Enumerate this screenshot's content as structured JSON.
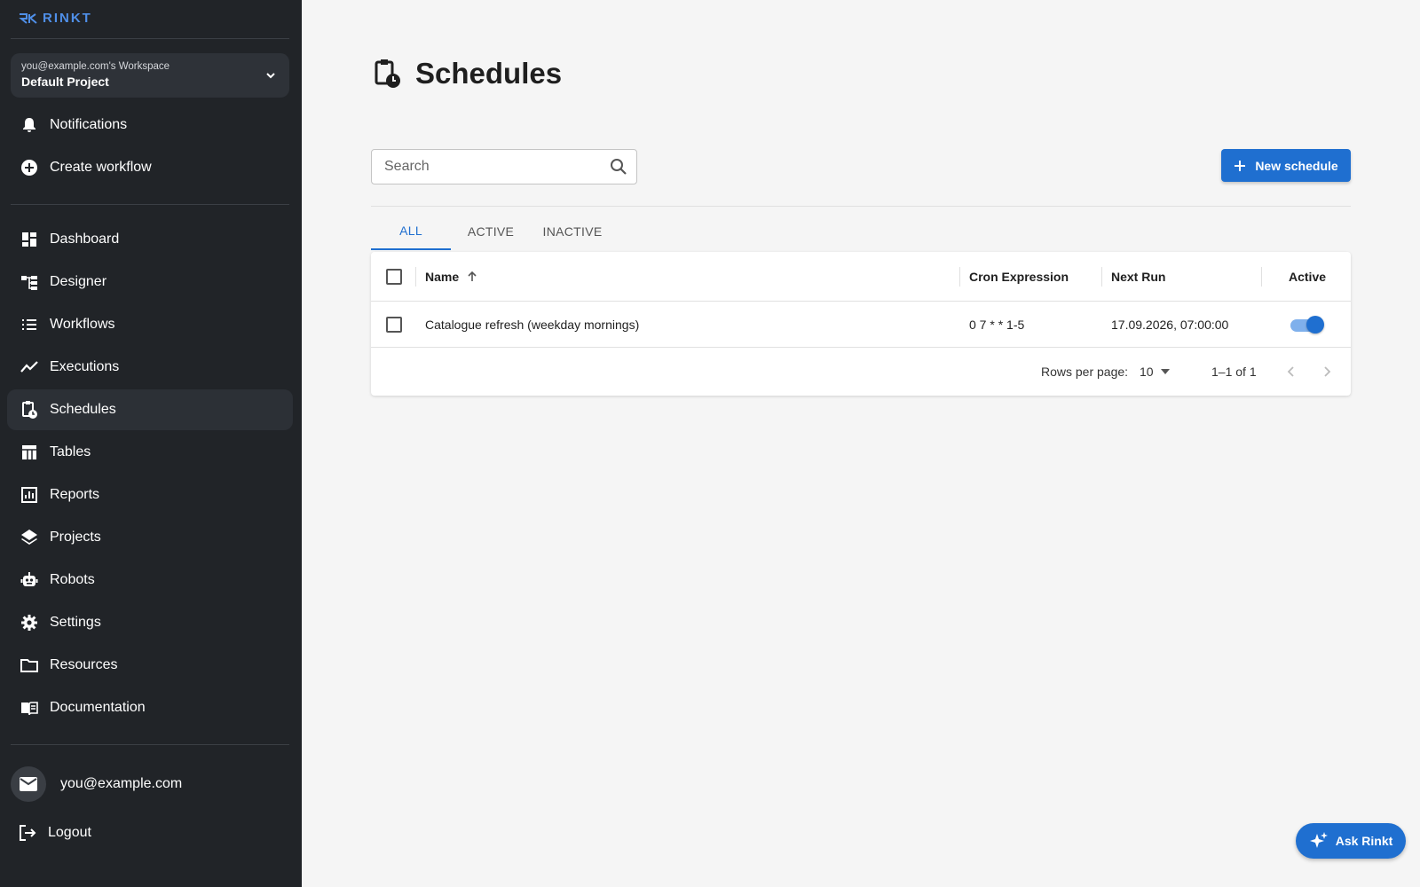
{
  "brand": {
    "logo_text": "RINKT",
    "accent": "#1f6fd0",
    "sidebar_bg": "#212428"
  },
  "workspace": {
    "owner": "you@example.com's Workspace",
    "project": "Default Project"
  },
  "sidebar": {
    "top_items": [
      {
        "label": "Notifications",
        "icon": "bell-icon"
      },
      {
        "label": "Create workflow",
        "icon": "add-circle-icon"
      }
    ],
    "items": [
      {
        "label": "Dashboard",
        "icon": "dashboard-icon"
      },
      {
        "label": "Designer",
        "icon": "designer-icon"
      },
      {
        "label": "Workflows",
        "icon": "list-icon"
      },
      {
        "label": "Executions",
        "icon": "trending-icon"
      },
      {
        "label": "Schedules",
        "icon": "schedule-clipboard-icon",
        "active": true
      },
      {
        "label": "Tables",
        "icon": "table-icon"
      },
      {
        "label": "Reports",
        "icon": "report-icon"
      },
      {
        "label": "Projects",
        "icon": "layers-icon"
      },
      {
        "label": "Robots",
        "icon": "robot-icon"
      },
      {
        "label": "Settings",
        "icon": "gear-icon"
      },
      {
        "label": "Resources",
        "icon": "folder-icon"
      },
      {
        "label": "Documentation",
        "icon": "book-icon"
      }
    ],
    "user_email": "you@example.com",
    "logout_label": "Logout"
  },
  "main": {
    "title": "Schedules",
    "search_placeholder": "Search",
    "new_button_label": "New schedule",
    "tabs": [
      {
        "label": "ALL",
        "active": true
      },
      {
        "label": "ACTIVE"
      },
      {
        "label": "INACTIVE"
      }
    ],
    "table": {
      "columns": [
        "Name",
        "Cron Expression",
        "Next Run",
        "Active"
      ],
      "sort": {
        "column": "Name",
        "direction": "asc"
      },
      "rows": [
        {
          "name": "Catalogue refresh (weekday mornings)",
          "cron": "0 7 * * 1-5",
          "next_run": "17.09.2026, 07:00:00",
          "active": true
        }
      ],
      "footer": {
        "rows_per_page_label": "Rows per page:",
        "rows_per_page": "10",
        "range": "1–1 of 1"
      }
    }
  },
  "ask_button_label": "Ask Rinkt"
}
